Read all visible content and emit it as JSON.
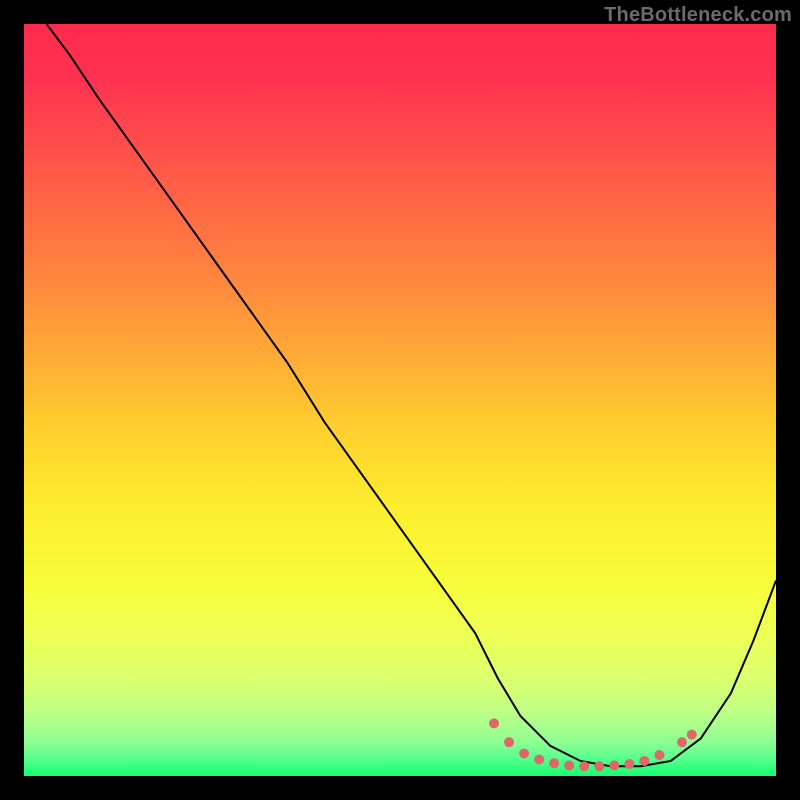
{
  "watermark": "TheBottleneck.com",
  "chart_data": {
    "type": "line",
    "title": "",
    "xlabel": "",
    "ylabel": "",
    "xlim": [
      0,
      100
    ],
    "ylim": [
      0,
      100
    ],
    "grid": false,
    "legend": false,
    "gradient_stops": [
      {
        "offset": 0.0,
        "color": "#ff2b4d"
      },
      {
        "offset": 0.07,
        "color": "#ff3150"
      },
      {
        "offset": 0.15,
        "color": "#ff4a4c"
      },
      {
        "offset": 0.25,
        "color": "#ff6a44"
      },
      {
        "offset": 0.35,
        "color": "#ff8a3d"
      },
      {
        "offset": 0.45,
        "color": "#ffae35"
      },
      {
        "offset": 0.55,
        "color": "#ffd32e"
      },
      {
        "offset": 0.65,
        "color": "#fdef2f"
      },
      {
        "offset": 0.75,
        "color": "#f7fd3c"
      },
      {
        "offset": 0.82,
        "color": "#ecff57"
      },
      {
        "offset": 0.88,
        "color": "#d7ff73"
      },
      {
        "offset": 0.92,
        "color": "#b9ff88"
      },
      {
        "offset": 0.955,
        "color": "#8dff93"
      },
      {
        "offset": 0.975,
        "color": "#5cff8f"
      },
      {
        "offset": 0.99,
        "color": "#2fff7d"
      },
      {
        "offset": 1.0,
        "color": "#17ff6e"
      }
    ],
    "series": [
      {
        "name": "bottleneck-curve",
        "color": "#000000",
        "x": [
          3,
          6,
          10,
          15,
          20,
          25,
          30,
          35,
          40,
          45,
          50,
          55,
          60,
          63,
          66,
          70,
          74,
          78,
          82,
          86,
          90,
          94,
          97,
          100
        ],
        "y": [
          100,
          96,
          90,
          83,
          76,
          69,
          62,
          55,
          47,
          40,
          33,
          26,
          19,
          13,
          8,
          4,
          2,
          1.3,
          1.3,
          2,
          5,
          11,
          18,
          26
        ]
      }
    ],
    "markers": {
      "color": "#de6868",
      "radius_px": 5,
      "points": [
        {
          "x": 62.5,
          "y": 7.0
        },
        {
          "x": 64.5,
          "y": 4.5
        },
        {
          "x": 66.5,
          "y": 3.0
        },
        {
          "x": 68.5,
          "y": 2.2
        },
        {
          "x": 70.5,
          "y": 1.7
        },
        {
          "x": 72.5,
          "y": 1.4
        },
        {
          "x": 74.5,
          "y": 1.3
        },
        {
          "x": 76.5,
          "y": 1.3
        },
        {
          "x": 78.5,
          "y": 1.4
        },
        {
          "x": 80.5,
          "y": 1.6
        },
        {
          "x": 82.5,
          "y": 2.0
        },
        {
          "x": 84.5,
          "y": 2.8
        },
        {
          "x": 87.5,
          "y": 4.5
        },
        {
          "x": 88.8,
          "y": 5.5
        }
      ]
    }
  }
}
